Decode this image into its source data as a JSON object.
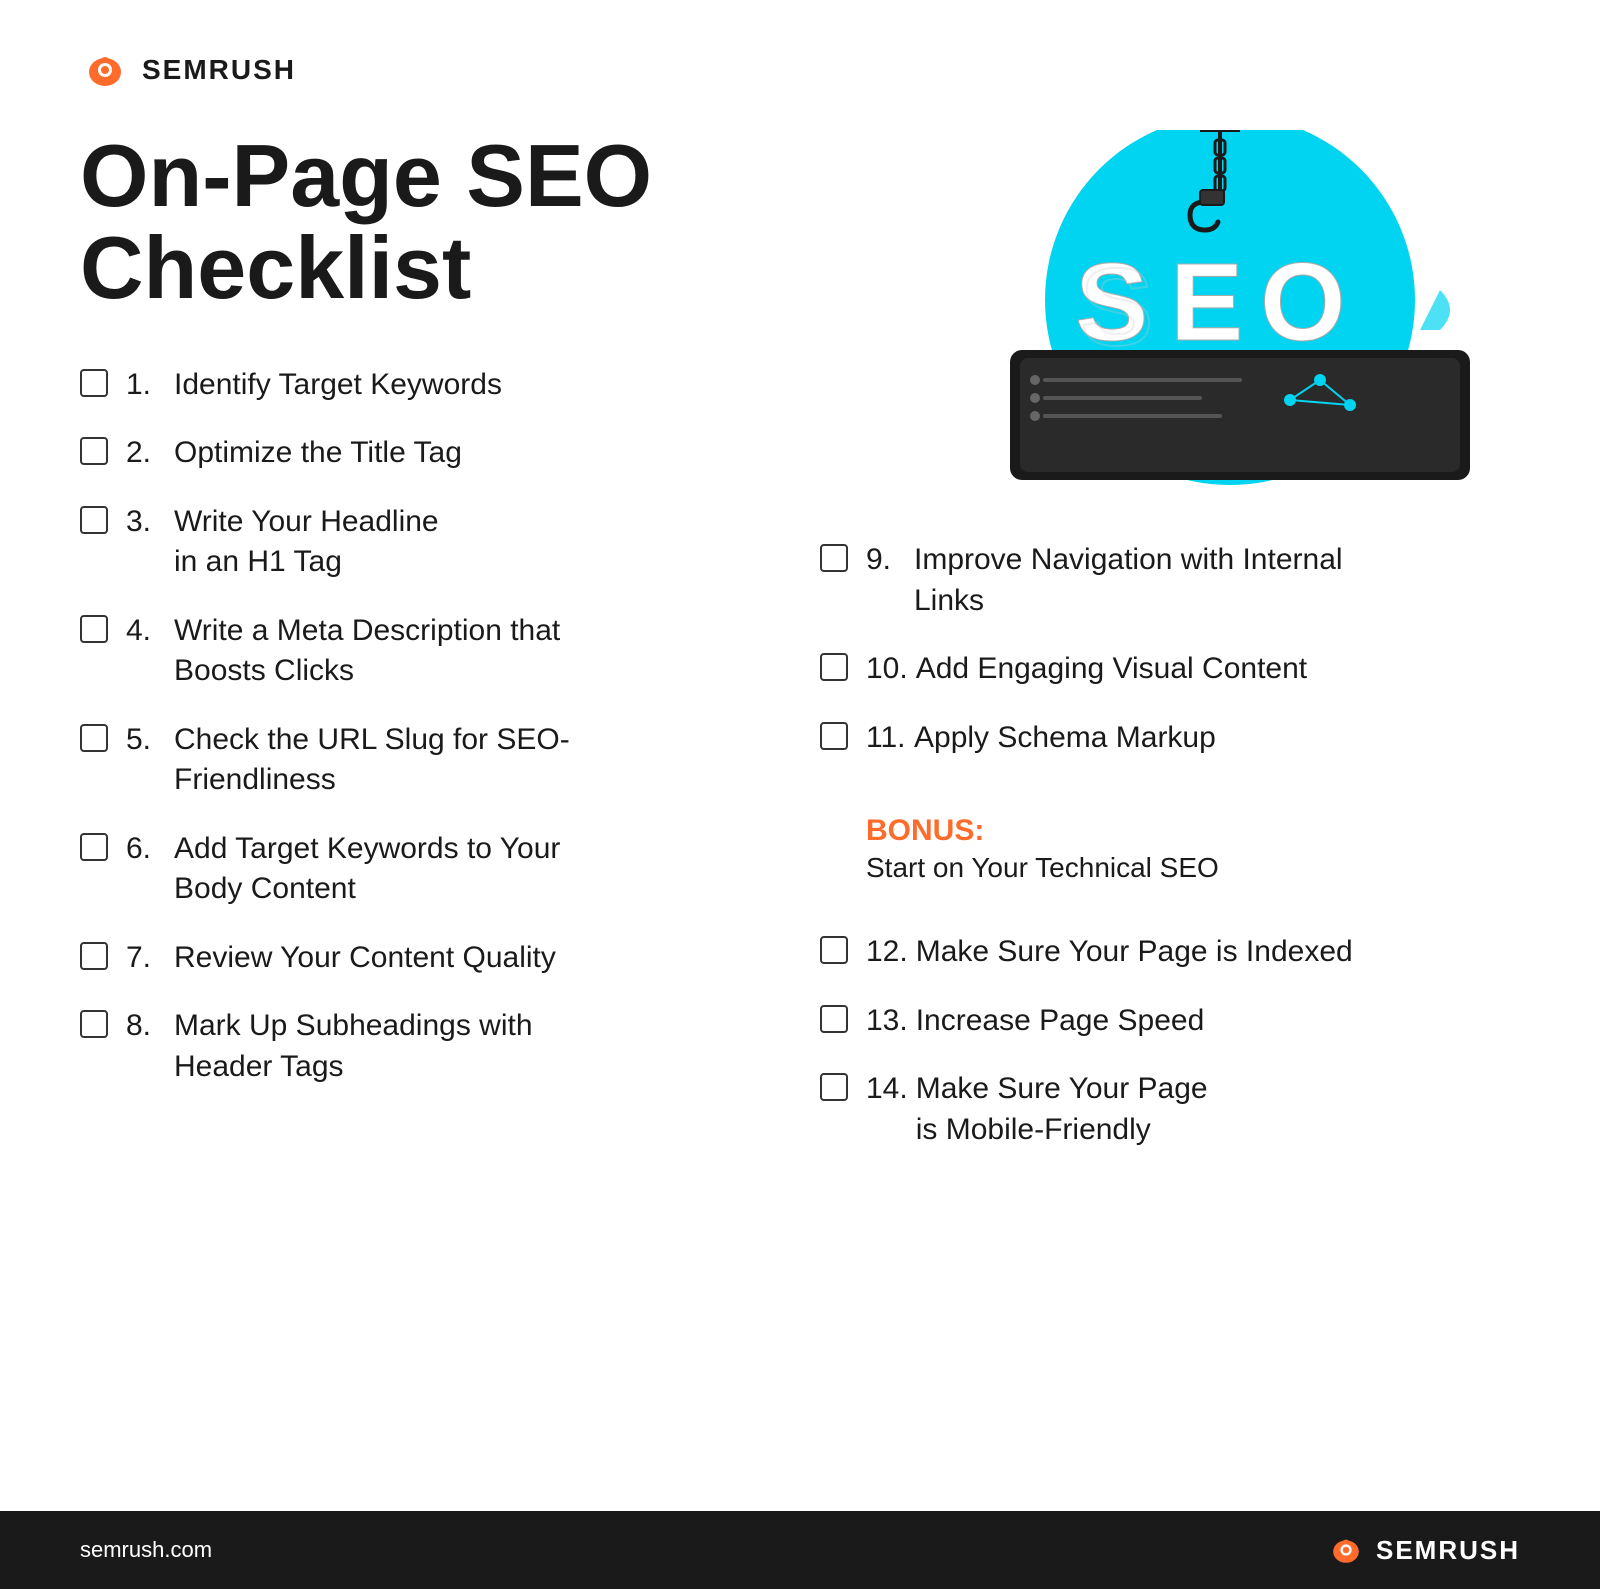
{
  "logo": {
    "text": "SEMRUSH"
  },
  "title": "On-Page SEO Checklist",
  "left_items": [
    {
      "number": "1.",
      "label": "Identify Target Keywords"
    },
    {
      "number": "2.",
      "label": "Optimize the Title Tag"
    },
    {
      "number": "3.",
      "label": "Write Your Headline\nin an H1 Tag"
    },
    {
      "number": "4.",
      "label": "Write a Meta Description that\nBoosts Clicks"
    },
    {
      "number": "5.",
      "label": "Check the URL Slug for SEO-\nFriendliness"
    },
    {
      "number": "6.",
      "label": "Add Target Keywords to Your\nBody Content"
    },
    {
      "number": "7.",
      "label": "Review Your Content Quality"
    },
    {
      "number": "8.",
      "label": "Mark Up Subheadings with\nHeader Tags"
    }
  ],
  "right_items": [
    {
      "number": "9.",
      "label": "Improve Navigation with Internal\nLinks"
    },
    {
      "number": "10.",
      "label": "Add Engaging Visual Content"
    },
    {
      "number": "11.",
      "label": "Apply Schema Markup"
    },
    {
      "number": "12.",
      "label": "Make Sure Your Page is Indexed"
    },
    {
      "number": "13.",
      "label": "Increase Page Speed"
    },
    {
      "number": "14.",
      "label": "Make Sure Your Page\nis Mobile-Friendly"
    }
  ],
  "bonus": {
    "title": "BONUS:",
    "subtitle": "Start on Your Technical SEO"
  },
  "footer": {
    "url": "semrush.com",
    "logo_text": "SEMRUSH"
  },
  "colors": {
    "orange": "#ff6b2b",
    "dark": "#1a1a1a",
    "cyan": "#00d4f0"
  }
}
